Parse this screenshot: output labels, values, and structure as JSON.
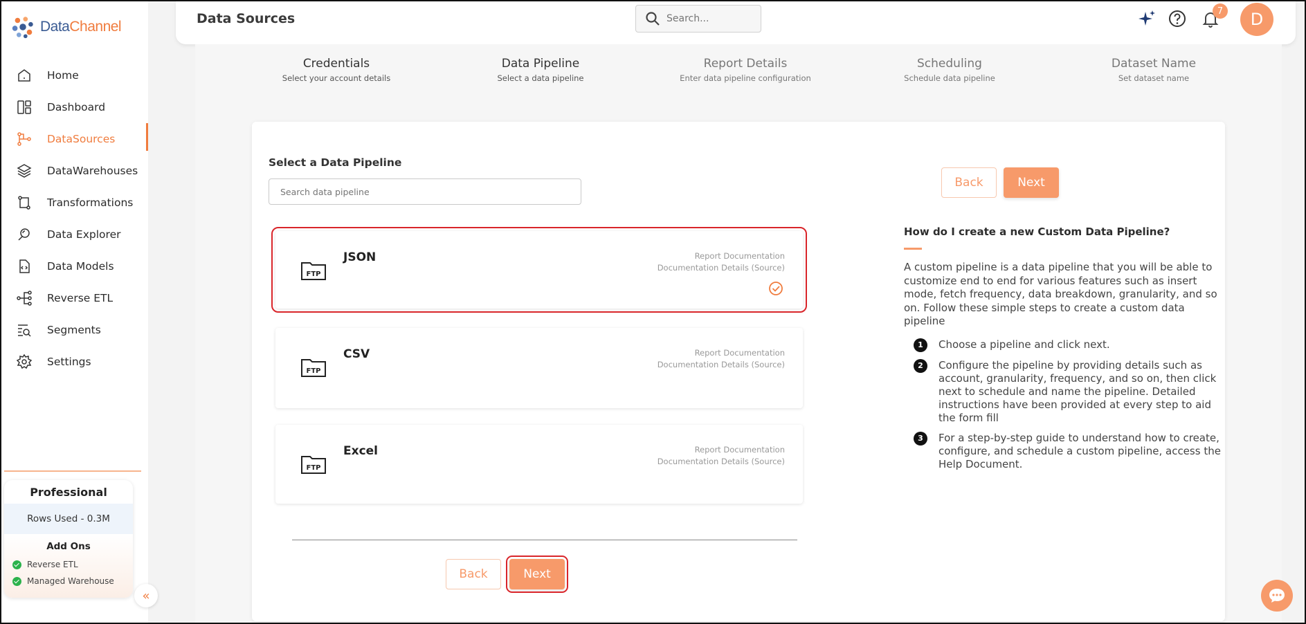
{
  "brand": {
    "name_part1": "Data",
    "name_part2": "Channel"
  },
  "sidebar": {
    "items": [
      {
        "label": "Home",
        "icon": "home-icon"
      },
      {
        "label": "Dashboard",
        "icon": "dashboard-icon"
      },
      {
        "label": "DataSources",
        "icon": "datasources-icon",
        "active": true
      },
      {
        "label": "DataWarehouses",
        "icon": "layers-icon"
      },
      {
        "label": "Transformations",
        "icon": "transform-icon"
      },
      {
        "label": "Data Explorer",
        "icon": "explorer-icon"
      },
      {
        "label": "Data Models",
        "icon": "model-icon"
      },
      {
        "label": "Reverse ETL",
        "icon": "reverse-etl-icon"
      },
      {
        "label": "Segments",
        "icon": "segments-icon"
      },
      {
        "label": "Settings",
        "icon": "gear-icon"
      }
    ],
    "plan": {
      "title": "Professional",
      "rows_used": "Rows Used - 0.3M",
      "addons_title": "Add Ons",
      "addons": [
        "Reverse ETL",
        "Managed Warehouse"
      ]
    }
  },
  "header": {
    "title": "Data Sources",
    "search_placeholder": "Search...",
    "notification_count": "7",
    "avatar_initial": "D"
  },
  "steps": [
    {
      "title": "Credentials",
      "subtitle": "Select your account details"
    },
    {
      "title": "Data Pipeline",
      "subtitle": "Select a data pipeline"
    },
    {
      "title": "Report Details",
      "subtitle": "Enter data pipeline configuration"
    },
    {
      "title": "Scheduling",
      "subtitle": "Schedule data pipeline"
    },
    {
      "title": "Dataset Name",
      "subtitle": "Set dataset name"
    }
  ],
  "selector": {
    "title": "Select a Data Pipeline",
    "search_placeholder": "Search data pipeline",
    "back_label": "Back",
    "next_label": "Next"
  },
  "pipelines": [
    {
      "name": "JSON",
      "icon_label": "FTP",
      "doc1": "Report Documentation",
      "doc2": "Documentation Details (Source)",
      "selected": true
    },
    {
      "name": "CSV",
      "icon_label": "FTP",
      "doc1": "Report Documentation",
      "doc2": "Documentation Details (Source)",
      "selected": false
    },
    {
      "name": "Excel",
      "icon_label": "FTP",
      "doc1": "Report Documentation",
      "doc2": "Documentation Details (Source)",
      "selected": false
    }
  ],
  "help": {
    "title": "How do I create a new Custom Data Pipeline?",
    "body": "A custom pipeline is a data pipeline that you will be able to customize end to end for various features such as insert mode, fetch frequency, data breakdown, granularity, and so on. Follow these simple steps to create a custom data pipeline",
    "steps": [
      {
        "num": "1",
        "text": "Choose a pipeline and click next."
      },
      {
        "num": "2",
        "text": "Configure the pipeline by providing details such as account, granularity, frequency, and so on, then click next to schedule and name the pipeline. Detailed instructions have been provided at every step to aid the form fill"
      },
      {
        "num": "3",
        "text": "For a step-by-step guide to understand how to create, configure, and schedule a custom pipeline, access the Help Document."
      }
    ]
  },
  "colors": {
    "accent": "#f79a6a",
    "brand_blue": "#3a5b93",
    "brand_orange": "#f07c3e",
    "highlight": "#d9252a"
  }
}
